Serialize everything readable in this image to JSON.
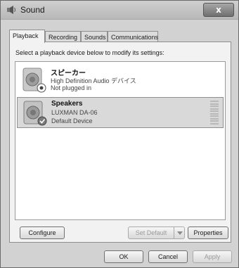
{
  "window": {
    "title": "Sound",
    "close_glyph": "x"
  },
  "tabs": [
    {
      "label": "Playback",
      "active": true
    },
    {
      "label": "Recording",
      "active": false
    },
    {
      "label": "Sounds",
      "active": false
    },
    {
      "label": "Communications",
      "active": false
    }
  ],
  "panel": {
    "instruction": "Select a playback device below to modify its settings:"
  },
  "devices": [
    {
      "name": "スピーカー",
      "line1": "High Definition Audio デバイス",
      "line2": "Not plugged in",
      "status_icon": "unplugged-badge-icon",
      "selected": false
    },
    {
      "name": "Speakers",
      "line1": "LUXMAN DA-06",
      "line2": "Default Device",
      "status_icon": "default-check-icon",
      "selected": true
    }
  ],
  "buttons": {
    "configure": "Configure",
    "set_default": "Set Default",
    "properties": "Properties",
    "ok": "OK",
    "cancel": "Cancel",
    "apply": "Apply"
  }
}
